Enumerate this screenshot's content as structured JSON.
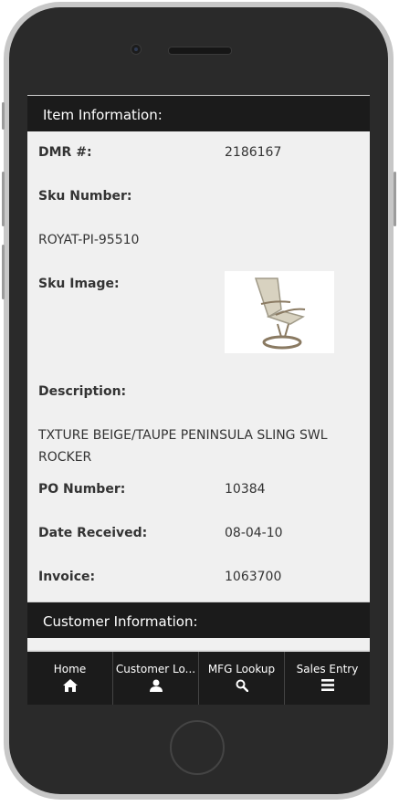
{
  "item_section": {
    "header": "Item Information:",
    "dmr_label": "DMR #:",
    "dmr_value": "2186167",
    "sku_label": "Sku Number:",
    "sku_value": "ROYAT-PI-95510",
    "image_label": "Sku Image:",
    "description_label": "Description:",
    "description_value": "TXTURE BEIGE/TAUPE PENINSULA SLING SWL ROCKER",
    "po_label": "PO Number:",
    "po_value": "10384",
    "date_label": "Date Received:",
    "date_value": "08-04-10",
    "invoice_label": "Invoice:",
    "invoice_value": "1063700"
  },
  "customer_section": {
    "header": "Customer Information:"
  },
  "tabbar": {
    "tabs": [
      {
        "label": "Home",
        "icon": "home-icon"
      },
      {
        "label": "Customer Lo...",
        "icon": "user-icon"
      },
      {
        "label": "MFG Lookup",
        "icon": "search-icon"
      },
      {
        "label": "Sales Entry",
        "icon": "menu-icon"
      }
    ]
  }
}
